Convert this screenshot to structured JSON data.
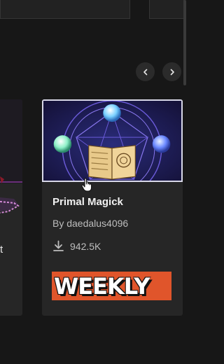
{
  "carousel": {
    "prev_icon": "chevron-left-icon",
    "next_icon": "chevron-right-icon"
  },
  "left_card": {
    "label_fragment": "t"
  },
  "card": {
    "title": "Primal Magick",
    "author": "By daedalus4096",
    "download_icon": "download-icon",
    "downloads": "942.5K",
    "badge": "WEEKLY",
    "badge_color": "#e0552b"
  },
  "colors": {
    "background": "#171717",
    "card": "#262626"
  }
}
